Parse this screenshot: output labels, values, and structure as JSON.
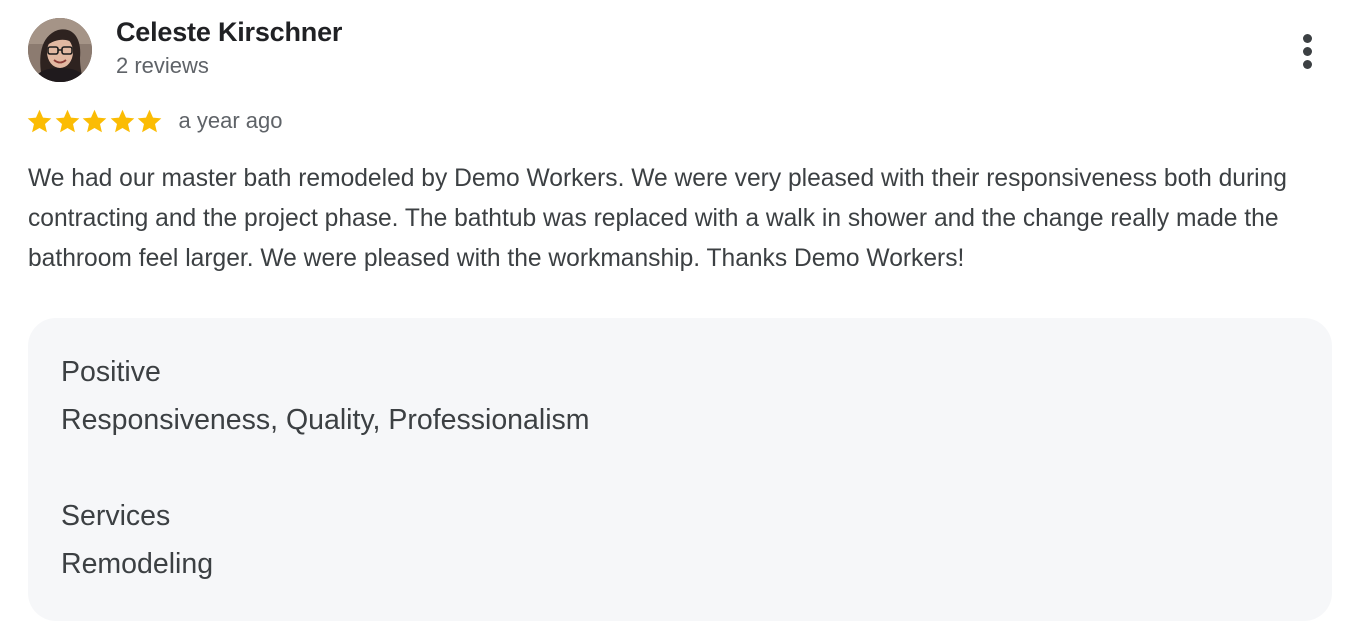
{
  "reviewer": {
    "name": "Celeste Kirschner",
    "review_count": "2 reviews"
  },
  "rating": {
    "stars": 5,
    "max_stars": 5,
    "star_color": "#fbbc04",
    "timestamp": "a year ago"
  },
  "review": {
    "text": "We had our master bath remodeled by Demo Workers. We were very pleased with their responsiveness both during contracting and the project phase. The bathtub was replaced with a walk in shower and the change really made the bathroom feel larger. We were pleased with the workmanship. Thanks Demo Workers!"
  },
  "attributes": {
    "positive_heading": "Positive",
    "positive_value": "Responsiveness, Quality, Professionalism",
    "services_heading": "Services",
    "services_value": "Remodeling"
  },
  "icons": {
    "menu": "more-vert-icon",
    "star": "star-icon"
  }
}
